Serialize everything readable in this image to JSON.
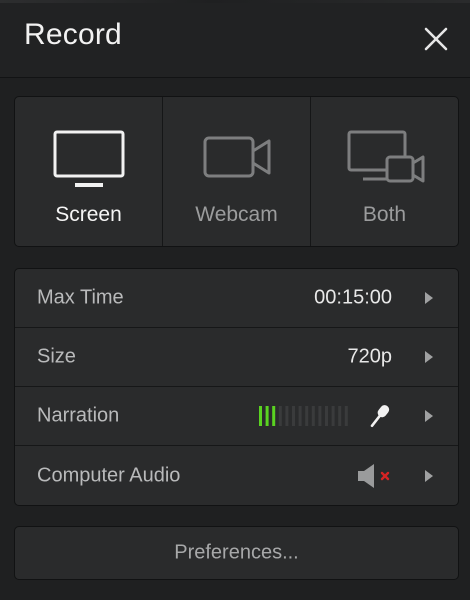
{
  "header": {
    "title": "Record"
  },
  "modes": [
    {
      "label": "Screen",
      "icon": "monitor-icon",
      "active": true
    },
    {
      "label": "Webcam",
      "icon": "webcam-icon",
      "active": false
    },
    {
      "label": "Both",
      "icon": "monitor-webcam-icon",
      "active": false
    }
  ],
  "settings": {
    "max_time": {
      "label": "Max Time",
      "value": "00:15:00"
    },
    "size": {
      "label": "Size",
      "value": "720p"
    },
    "narration": {
      "label": "Narration",
      "level_fraction": 0.18,
      "icon": "microphone-icon"
    },
    "computer_audio": {
      "label": "Computer Audio",
      "icon": "speaker-muted-icon"
    }
  },
  "preferences_label": "Preferences...",
  "colors": {
    "meter_active": "#5ad321",
    "meter_inactive": "#3a3b3c",
    "muted_x": "#d42424"
  }
}
